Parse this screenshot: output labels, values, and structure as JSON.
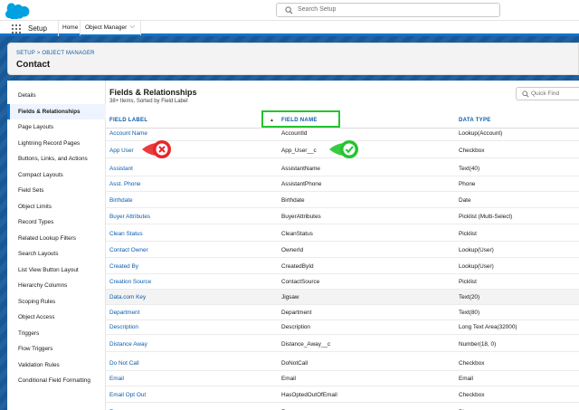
{
  "header": {
    "search_placeholder": "Search Setup"
  },
  "app_bar": {
    "app_name": "Setup",
    "nav_home": "Home",
    "nav_object_manager": "Object Manager"
  },
  "page": {
    "breadcrumb": "SETUP > OBJECT MANAGER",
    "title": "Contact"
  },
  "sidebar": {
    "items": [
      {
        "label": "Details"
      },
      {
        "label": "Fields & Relationships"
      },
      {
        "label": "Page Layouts"
      },
      {
        "label": "Lightning Record Pages"
      },
      {
        "label": "Buttons, Links, and Actions"
      },
      {
        "label": "Compact Layouts"
      },
      {
        "label": "Field Sets"
      },
      {
        "label": "Object Limits"
      },
      {
        "label": "Record Types"
      },
      {
        "label": "Related Lookup Filters"
      },
      {
        "label": "Search Layouts"
      },
      {
        "label": "List View Button Layout"
      },
      {
        "label": "Hierarchy Columns"
      },
      {
        "label": "Scoping Rules"
      },
      {
        "label": "Object Access"
      },
      {
        "label": "Triggers"
      },
      {
        "label": "Flow Triggers"
      },
      {
        "label": "Validation Rules"
      },
      {
        "label": "Conditional Field Formatting"
      }
    ],
    "active_index": 1
  },
  "section": {
    "title": "Fields & Relationships",
    "subtitle": "38+ Items, Sorted by Field Label",
    "quick_find_placeholder": "Quick Find"
  },
  "table": {
    "columns": {
      "field_label": "FIELD LABEL",
      "field_name": "FIELD NAME",
      "data_type": "DATA TYPE"
    },
    "rows": [
      {
        "label": "Account Name",
        "api": "AccountId",
        "type": "Lookup(Account)"
      },
      {
        "label": "App User",
        "api": "App_User__c",
        "type": "Checkbox"
      },
      {
        "label": "Assistant",
        "api": "AssistantName",
        "type": "Text(40)"
      },
      {
        "label": "Asst. Phone",
        "api": "AssistantPhone",
        "type": "Phone"
      },
      {
        "label": "Birthdate",
        "api": "Birthdate",
        "type": "Date"
      },
      {
        "label": "Buyer Attributes",
        "api": "BuyerAttributes",
        "type": "Picklist (Multi-Select)"
      },
      {
        "label": "Clean Status",
        "api": "CleanStatus",
        "type": "Picklist"
      },
      {
        "label": "Contact Owner",
        "api": "OwnerId",
        "type": "Lookup(User)"
      },
      {
        "label": "Created By",
        "api": "CreatedById",
        "type": "Lookup(User)"
      },
      {
        "label": "Creation Source",
        "api": "ContactSource",
        "type": "Picklist"
      },
      {
        "label": "Data.com Key",
        "api": "Jigsaw",
        "type": "Text(20)"
      },
      {
        "label": "Department",
        "api": "Department",
        "type": "Text(80)"
      },
      {
        "label": "Description",
        "api": "Description",
        "type": "Long Text Area(32000)"
      },
      {
        "label": "Distance Away",
        "api": "Distance_Away__c",
        "type": "Number(18, 0)"
      },
      {
        "label": "Do Not Call",
        "api": "DoNotCall",
        "type": "Checkbox"
      },
      {
        "label": "Email",
        "api": "Email",
        "type": "Email"
      },
      {
        "label": "Email Opt Out",
        "api": "HasOptedOutOfEmail",
        "type": "Checkbox"
      },
      {
        "label": "Fax",
        "api": "Fax",
        "type": "Phone"
      }
    ]
  },
  "annotations": {
    "wrong_icon": "x-circle-icon",
    "correct_icon": "check-circle-icon",
    "wrong_color": "#e8262a",
    "correct_color": "#22c52e"
  }
}
